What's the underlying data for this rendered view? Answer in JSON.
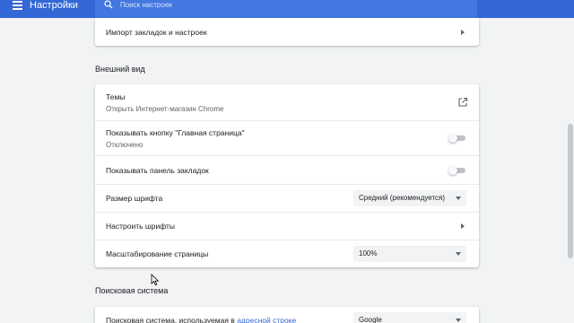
{
  "header": {
    "title": "Настройки",
    "search_placeholder": "Поиск настроек"
  },
  "import_card": {
    "label": "Импорт закладок и настроек"
  },
  "appearance": {
    "section_title": "Внешний вид",
    "themes_label": "Темы",
    "themes_sub": "Открыть Интернет-магазин Chrome",
    "home_button_label": "Показывать кнопку \"Главная страница\"",
    "home_button_sub": "Отключено",
    "home_button_on": false,
    "bookmarks_bar_label": "Показывать панель закладок",
    "bookmarks_bar_on": false,
    "font_size_label": "Размер шрифта",
    "font_size_value": "Средний (рекомендуется)",
    "customize_fonts_label": "Настроить шрифты",
    "page_zoom_label": "Масштабирование страницы",
    "page_zoom_value": "100%"
  },
  "search_engine": {
    "section_title": "Поисковая система",
    "label_prefix": "Поисковая система, используемая в ",
    "label_link": "адресной строке",
    "value": "Google"
  },
  "colors": {
    "toolbar": "#3367d6",
    "background": "#f1f3f4",
    "link": "#3367d6"
  }
}
